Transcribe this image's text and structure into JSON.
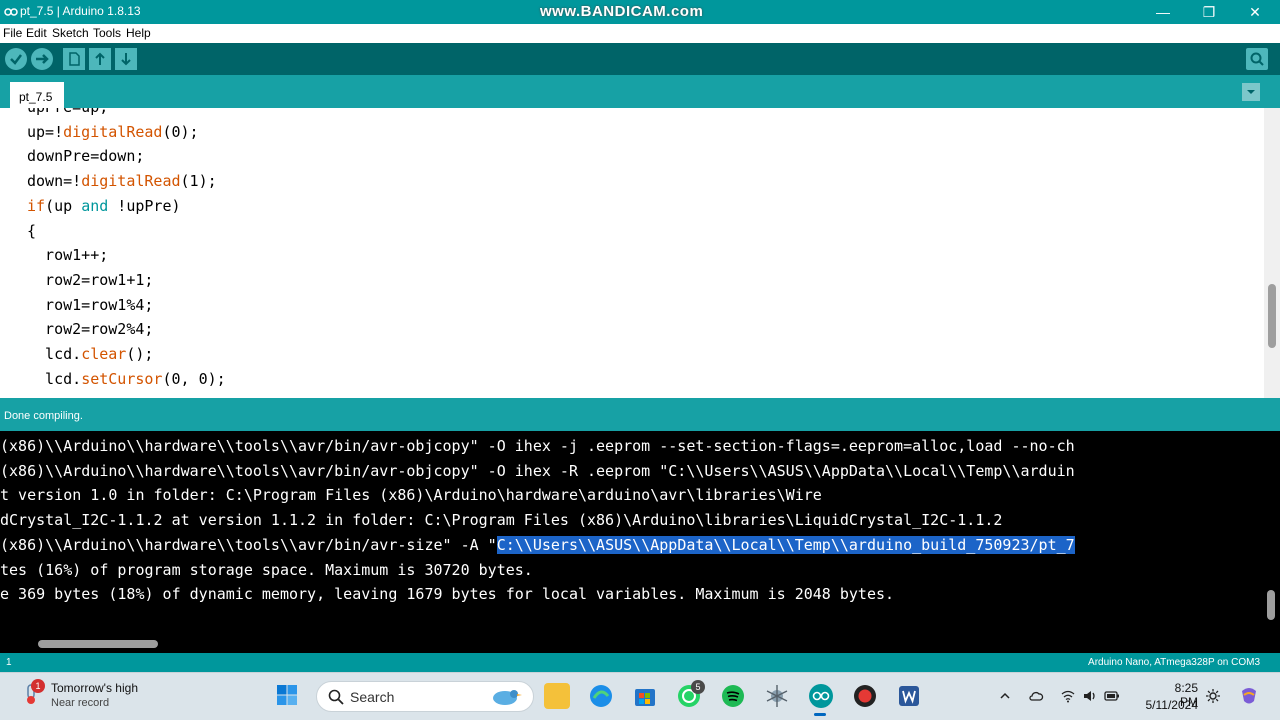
{
  "window": {
    "title": "pt_7.5 | Arduino 1.8.13",
    "watermark": "www.BANDICAM.com",
    "controls": {
      "minimize": "—",
      "maximize": "❐",
      "close": "✕"
    }
  },
  "menu": [
    "File",
    "Edit",
    "Sketch",
    "Tools",
    "Help"
  ],
  "toolbar": {
    "buttons": [
      "verify",
      "upload",
      "new",
      "open",
      "save"
    ],
    "serial_monitor": "serial-monitor"
  },
  "tabs": [
    {
      "label": "pt_7.5"
    }
  ],
  "editor": {
    "lines": [
      [
        {
          "t": "upPre=up;",
          "c": ""
        }
      ],
      [
        {
          "t": "up=!",
          "c": ""
        },
        {
          "t": "digitalRead",
          "c": "kw"
        },
        {
          "t": "(0);",
          "c": ""
        }
      ],
      [
        {
          "t": "downPre=down;",
          "c": ""
        }
      ],
      [
        {
          "t": "down=!",
          "c": ""
        },
        {
          "t": "digitalRead",
          "c": "kw"
        },
        {
          "t": "(1);",
          "c": ""
        }
      ],
      [
        {
          "t": "if",
          "c": "kw"
        },
        {
          "t": "(up ",
          "c": ""
        },
        {
          "t": "and",
          "c": "kw2"
        },
        {
          "t": " !upPre)",
          "c": ""
        }
      ],
      [
        {
          "t": "{",
          "c": ""
        }
      ],
      [
        {
          "t": "  row1++;",
          "c": ""
        }
      ],
      [
        {
          "t": "  row2=row1+1;",
          "c": ""
        }
      ],
      [
        {
          "t": "  row1=row1%4;",
          "c": ""
        }
      ],
      [
        {
          "t": "  row2=row2%4;",
          "c": ""
        }
      ],
      [
        {
          "t": "  lcd.",
          "c": ""
        },
        {
          "t": "clear",
          "c": "kw"
        },
        {
          "t": "();",
          "c": ""
        }
      ],
      [
        {
          "t": "  lcd.",
          "c": ""
        },
        {
          "t": "setCursor",
          "c": "kw"
        },
        {
          "t": "(0, 0);",
          "c": ""
        }
      ]
    ]
  },
  "status_message": "Done compiling.",
  "console": {
    "lines": [
      {
        "pre": "(x86)\\\\Arduino\\\\hardware\\\\tools\\\\avr/bin/avr-objcopy\" -O ihex -j .eeprom --set-section-flags=.eeprom=alloc,load --no-ch",
        "sel": "",
        "post": ""
      },
      {
        "pre": "(x86)\\\\Arduino\\\\hardware\\\\tools\\\\avr/bin/avr-objcopy\" -O ihex -R .eeprom \"C:\\\\Users\\\\ASUS\\\\AppData\\\\Local\\\\Temp\\\\arduin",
        "sel": "",
        "post": ""
      },
      {
        "pre": "t version 1.0 in folder: C:\\Program Files (x86)\\Arduino\\hardware\\arduino\\avr\\libraries\\Wire",
        "sel": "",
        "post": ""
      },
      {
        "pre": "dCrystal_I2C-1.1.2 at version 1.1.2 in folder: C:\\Program Files (x86)\\Arduino\\libraries\\LiquidCrystal_I2C-1.1.2",
        "sel": "",
        "post": ""
      },
      {
        "pre": "(x86)\\\\Arduino\\\\hardware\\\\tools\\\\avr/bin/avr-size\" -A \"",
        "sel": "C:\\\\Users\\\\ASUS\\\\AppData\\\\Local\\\\Temp\\\\arduino_build_750923/pt_7",
        "post": ""
      },
      {
        "pre": "tes (16%) of program storage space. Maximum is 30720 bytes.",
        "sel": "",
        "post": ""
      },
      {
        "pre": "e 369 bytes (18%) of dynamic memory, leaving 1679 bytes for local variables. Maximum is 2048 bytes.",
        "sel": "",
        "post": ""
      }
    ]
  },
  "bottom_status": {
    "line": "1",
    "board": "Arduino Nano, ATmega328P on COM3"
  },
  "taskbar": {
    "weather_title": "Tomorrow's high",
    "weather_subtitle": "Near record",
    "weather_badge": "1",
    "search_placeholder": "Search",
    "whatsapp_badge": "5",
    "time": "8:25 PM",
    "date": "5/11/2024"
  },
  "colors": {
    "arduino_teal": "#00979c",
    "toolbar_dark": "#006468",
    "selection": "#1c64c8"
  }
}
